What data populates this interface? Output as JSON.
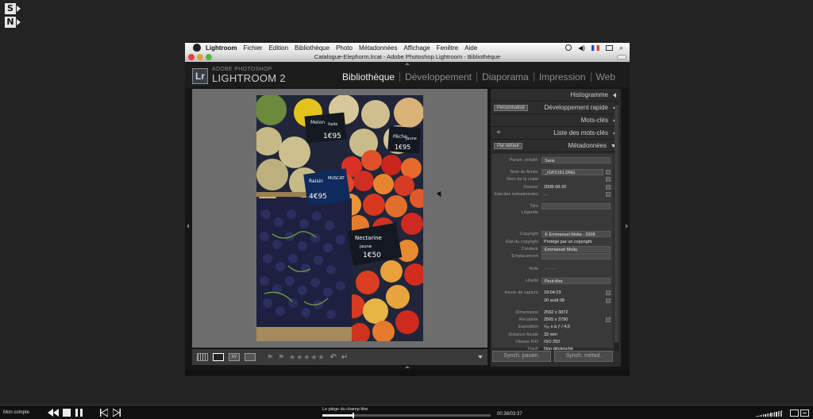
{
  "corner_icons": [
    "S",
    "N"
  ],
  "menubar": {
    "app_name": "Lightroom",
    "items": [
      "Fichier",
      "Edition",
      "Bibliothèque",
      "Photo",
      "Métadonnées",
      "Affichage",
      "Fenêtre",
      "Aide"
    ]
  },
  "window": {
    "title": "Catalogue-Elephorm.lrcat - Adobe Photoshop Lightroom - Bibliothèque"
  },
  "lightroom": {
    "badge": "Lr",
    "brand_small": "ADOBE PHOTOSHOP",
    "brand": "LIGHTROOM 2",
    "modules": [
      "Bibliothèque",
      "Développement",
      "Diaporama",
      "Impression",
      "Web"
    ],
    "active_module": "Bibliothèque"
  },
  "panels": {
    "histogramme": "Histogramme",
    "dev_rapide": {
      "preset": "Personnalisé",
      "label": "Développement rapide"
    },
    "mots_cles": "Mots-clés",
    "liste_mots_cles": {
      "add": "+",
      "label": "Liste des mots-clés"
    },
    "metadonnees": {
      "preset": "Par défaut",
      "label": "Métadonnées"
    }
  },
  "metadata": {
    "param_predef": {
      "label": "Param. prédéf.",
      "value": "Sans"
    },
    "file_rows": [
      {
        "label": "Nom du fichier",
        "value": "_IGP2161.DNG"
      },
      {
        "label": "Nom de la copie",
        "value": ""
      },
      {
        "label": "Dossier",
        "value": "2008-08-20"
      },
      {
        "label": "Etat des métadonnées",
        "value": "..."
      }
    ],
    "titre": {
      "label": "Titre",
      "value": ""
    },
    "legende": {
      "label": "Légende",
      "value": ""
    },
    "rights_rows": [
      {
        "label": "Copyright",
        "value": "© Emmanuel Molia - 2008"
      },
      {
        "label": "Etat du copyright",
        "value": "Protégé par un copyright"
      },
      {
        "label": "Créateur",
        "value": "Emmanuel Molia"
      },
      {
        "label": "Emplacement",
        "value": ""
      }
    ],
    "note": {
      "label": "Note",
      "value": "· · · · ·"
    },
    "libelle": {
      "label": "Libellé",
      "value": "Peut-être"
    },
    "capture_rows": [
      {
        "label": "Heure de capture",
        "value": "18:04:23"
      },
      {
        "label": "",
        "value": "20 août 08"
      }
    ],
    "exif_rows": [
      {
        "label": "Dimensions",
        "value": "2592 x 3872"
      },
      {
        "label": "Recadrée",
        "value": "2565 x 3790"
      },
      {
        "label": "Exposition",
        "value": "¹⁄₆₀ s à ƒ / 4,5"
      },
      {
        "label": "Distance focale",
        "value": "33 mm"
      },
      {
        "label": "Vitesse ISO",
        "value": "ISO 250"
      },
      {
        "label": "Flash",
        "value": "Non déclenché"
      }
    ]
  },
  "sync": {
    "param": "Synch. param.",
    "metad": "Synch. métad."
  },
  "photo_signs": {
    "melon": "Melon",
    "melon_sub": "Italie",
    "melon_price": "1€95",
    "peche": "Pêche",
    "peche_sub": "jaune",
    "peche_price": "1€95",
    "raisin": "Raisin",
    "raisin_sub": "MUSCAT",
    "raisin_price": "4€95",
    "nect": "Nectarine",
    "nect_sub": "jaune",
    "nect_price": "1€50"
  },
  "player": {
    "account": "Mon compte",
    "chapter": "Le piège du champ titre",
    "time": "00:38/03:37",
    "progress": 0.18
  }
}
